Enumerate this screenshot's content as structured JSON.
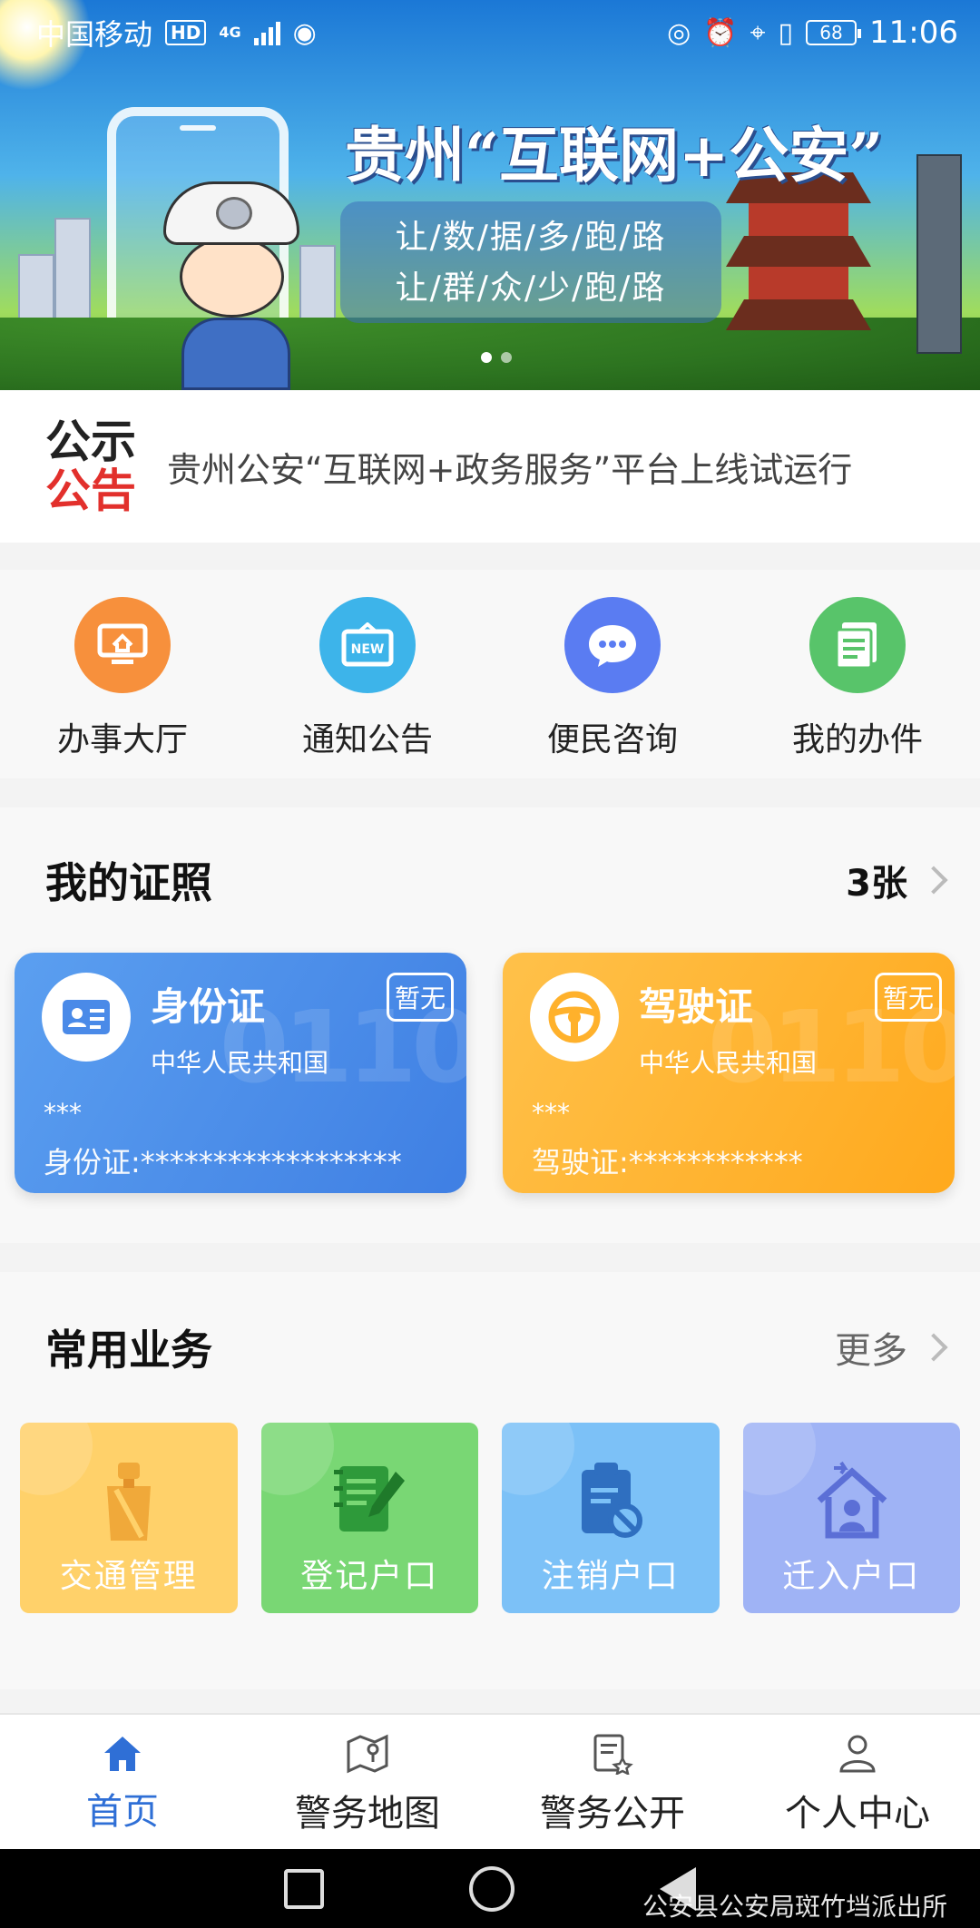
{
  "status_bar": {
    "carrier": "中国移动",
    "hd": "HD",
    "network": "4G",
    "battery": "68",
    "time": "11:06"
  },
  "banner": {
    "title": "贵州“互联网+公安”",
    "slogan_line1": "让/数/据/多/跑/路",
    "slogan_line2": "让/群/众/少/跑/路"
  },
  "notice": {
    "logo_top": "公示",
    "logo_bottom": "公告",
    "text": "贵州公安“互联网+政务服务”平台上线试运行"
  },
  "shortcuts": [
    {
      "label": "办事大厅",
      "color": "#f7903c",
      "icon": "monitor-home-icon"
    },
    {
      "label": "通知公告",
      "color": "#3db4ea",
      "icon": "new-board-icon"
    },
    {
      "label": "便民咨询",
      "color": "#5a7cf2",
      "icon": "chat-bubble-icon"
    },
    {
      "label": "我的办件",
      "color": "#58c46a",
      "icon": "document-icon"
    }
  ],
  "licenses": {
    "title": "我的证照",
    "count": "3张",
    "cards": [
      {
        "title": "身份证",
        "issuer": "中华人民共和国",
        "badge": "暂无",
        "name": "***",
        "number": "身份证:******************"
      },
      {
        "title": "驾驶证",
        "issuer": "中华人民共和国",
        "badge": "暂无",
        "name": "***",
        "number": "驾驶证:************"
      }
    ]
  },
  "services": {
    "title": "常用业务",
    "more": "更多",
    "items": [
      {
        "label": "交通管理",
        "icon": "traffic-police-icon"
      },
      {
        "label": "登记户口",
        "icon": "register-notebook-icon"
      },
      {
        "label": "注销户口",
        "icon": "cancel-clipboard-icon"
      },
      {
        "label": "迁入户口",
        "icon": "move-in-house-icon"
      }
    ]
  },
  "tabs": [
    {
      "label": "首页",
      "icon": "home-icon",
      "active": true
    },
    {
      "label": "警务地图",
      "icon": "map-icon",
      "active": false
    },
    {
      "label": "警务公开",
      "icon": "document-star-icon",
      "active": false
    },
    {
      "label": "个人中心",
      "icon": "user-icon",
      "active": false
    }
  ],
  "watermark": "公安县公安局斑竹垱派出所",
  "colors": {
    "accent": "#2f6fd6",
    "notice_red": "#e2302c",
    "id_card": "#4a8ae8",
    "license_card": "#ffb12b"
  }
}
